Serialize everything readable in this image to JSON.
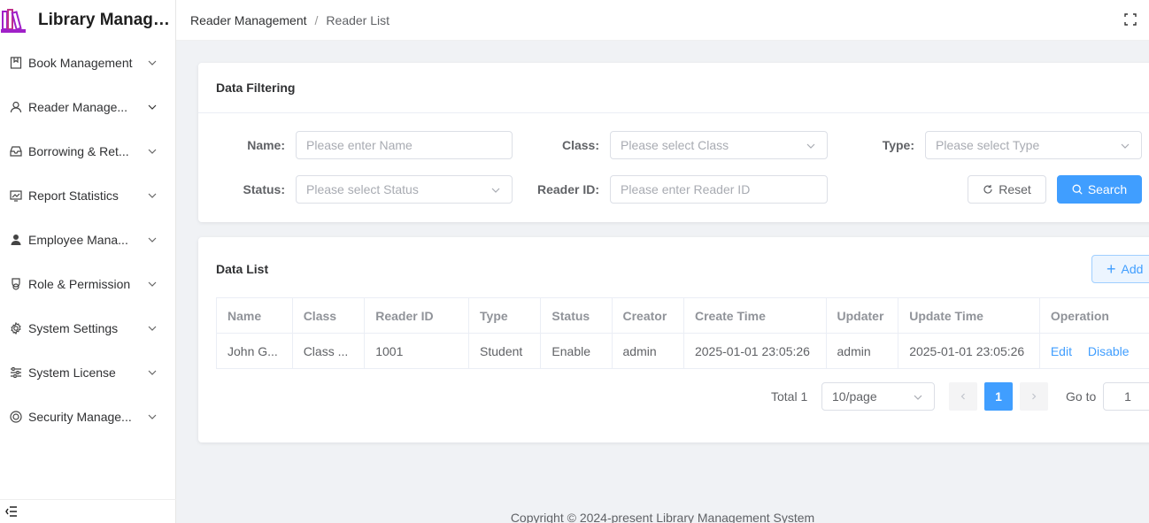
{
  "app": {
    "title": "Library Manage..."
  },
  "sidebar": {
    "items": [
      {
        "label": "Book Management",
        "icon": "book-icon"
      },
      {
        "label": "Reader Manage...",
        "icon": "user-icon"
      },
      {
        "label": "Borrowing & Ret...",
        "icon": "inbox-icon"
      },
      {
        "label": "Report Statistics",
        "icon": "chart-icon"
      },
      {
        "label": "Employee Mana...",
        "icon": "person-icon"
      },
      {
        "label": "Role & Permission",
        "icon": "medal-icon"
      },
      {
        "label": "System Settings",
        "icon": "gear-icon"
      },
      {
        "label": "System License",
        "icon": "sliders-icon"
      },
      {
        "label": "Security Manage...",
        "icon": "shield-icon"
      }
    ]
  },
  "header": {
    "breadcrumb": [
      "Reader Management",
      "Reader List"
    ],
    "separator": "/"
  },
  "filter": {
    "title": "Data Filtering",
    "name_label": "Name:",
    "name_placeholder": "Please enter Name",
    "class_label": "Class:",
    "class_placeholder": "Please select Class",
    "type_label": "Type:",
    "type_placeholder": "Please select Type",
    "status_label": "Status:",
    "status_placeholder": "Please select Status",
    "reader_id_label": "Reader ID:",
    "reader_id_placeholder": "Please enter Reader ID",
    "reset_label": "Reset",
    "search_label": "Search"
  },
  "list": {
    "title": "Data List",
    "add_label": "Add",
    "columns": [
      "Name",
      "Class",
      "Reader ID",
      "Type",
      "Status",
      "Creator",
      "Create Time",
      "Updater",
      "Update Time",
      "Operation"
    ],
    "rows": [
      {
        "name": "John G...",
        "class": "Class ...",
        "reader_id": "1001",
        "type": "Student",
        "status": "Enable",
        "creator": "admin",
        "create_time": "2025-01-01 23:05:26",
        "updater": "admin",
        "update_time": "2025-01-01 23:05:26",
        "edit": "Edit",
        "disable": "Disable"
      }
    ]
  },
  "pagination": {
    "total": "Total 1",
    "page_size": "10/page",
    "current_page": "1",
    "goto_label": "Go to",
    "goto_value": "1"
  },
  "footer": {
    "text": "Copyright © 2024-present  Library Management System"
  },
  "colors": {
    "primary": "#409eff",
    "logo": "#a020c8"
  }
}
